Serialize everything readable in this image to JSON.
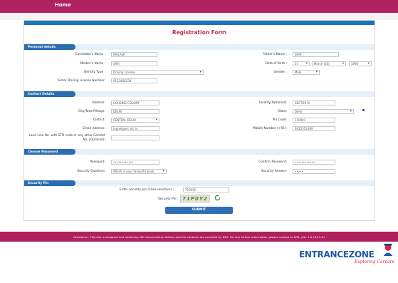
{
  "nav": {
    "home": "Home"
  },
  "form": {
    "title": "Registration Form"
  },
  "sections": {
    "personal": "Personal details",
    "contact": "Contact Details",
    "password": "Choose Password",
    "security": "Security Pin"
  },
  "personal": {
    "candidate_name_label": "Candidate's Name :",
    "candidate_name_value": "KAILASH",
    "father_name_label": "Father's Name :",
    "father_name_value": "SHIV",
    "mother_name_label": "Mother's Name :",
    "mother_name_value": "SATI",
    "dob_label": "Date of Birth :",
    "dob_day": "27",
    "dob_month": "March (03)",
    "dob_year": "1990",
    "id_type_label": "Identity Type :",
    "id_type_value": "Driving License",
    "gender_label": "Gender :",
    "gender_value": "Male",
    "license_label": "Enter Driving License Number:",
    "license_value": "0123456234"
  },
  "contact": {
    "address_label": "Address:",
    "address_value": "HOUSING COLONY",
    "locality_label": "Locality(Optional):",
    "locality_value": "SECTOR IV",
    "city_label": "City/Town/Village:",
    "city_value": "DELHI",
    "state_label": "State:",
    "state_value": "Delhi",
    "district_label": "District:",
    "district_value": "CENTRAL DELHI",
    "pincode_label": "Pin Code:",
    "pincode_value": "110001",
    "email_label": "Email Address:",
    "email_value": "jagnet@nic.nic.in",
    "mobile_label": "Mobile Number (+91):",
    "mobile_value": "9425352469",
    "landline_label_1": "Land Line No. with STD code or any other Contact",
    "landline_label_2": "No. (Optional):"
  },
  "password": {
    "password_label": "Password:",
    "password_value": "••••••••••••",
    "confirm_label": "Confirm Password:",
    "confirm_value": "••••••••••••",
    "question_label": "Security Question:",
    "question_value": "Which is your favourite book",
    "answer_label": "Security Answer:",
    "answer_value": "•••••"
  },
  "security": {
    "enter_pin_label": "Enter security pin (case sensitive) :",
    "enter_pin_value": "71P0Y2",
    "pin_label": "Security Pin :",
    "pin_value": "71P0Y2",
    "refresh_icon": "refresh-icon",
    "submit_label": "SUBMIT"
  },
  "footer": {
    "disclaimer": "Disclaimer: This site is designed and hosted by NIC eCounselling division and the contents are provided by NTA. For any further information, please contact to NTA. (Ver 1.0.155.2.0)"
  },
  "brand": {
    "name": "ENTRANCEZONE",
    "tagline": "Exploring Careers"
  },
  "colors": {
    "primary": "#b0215f",
    "accent": "#2a6db0",
    "title": "#c0304b"
  }
}
